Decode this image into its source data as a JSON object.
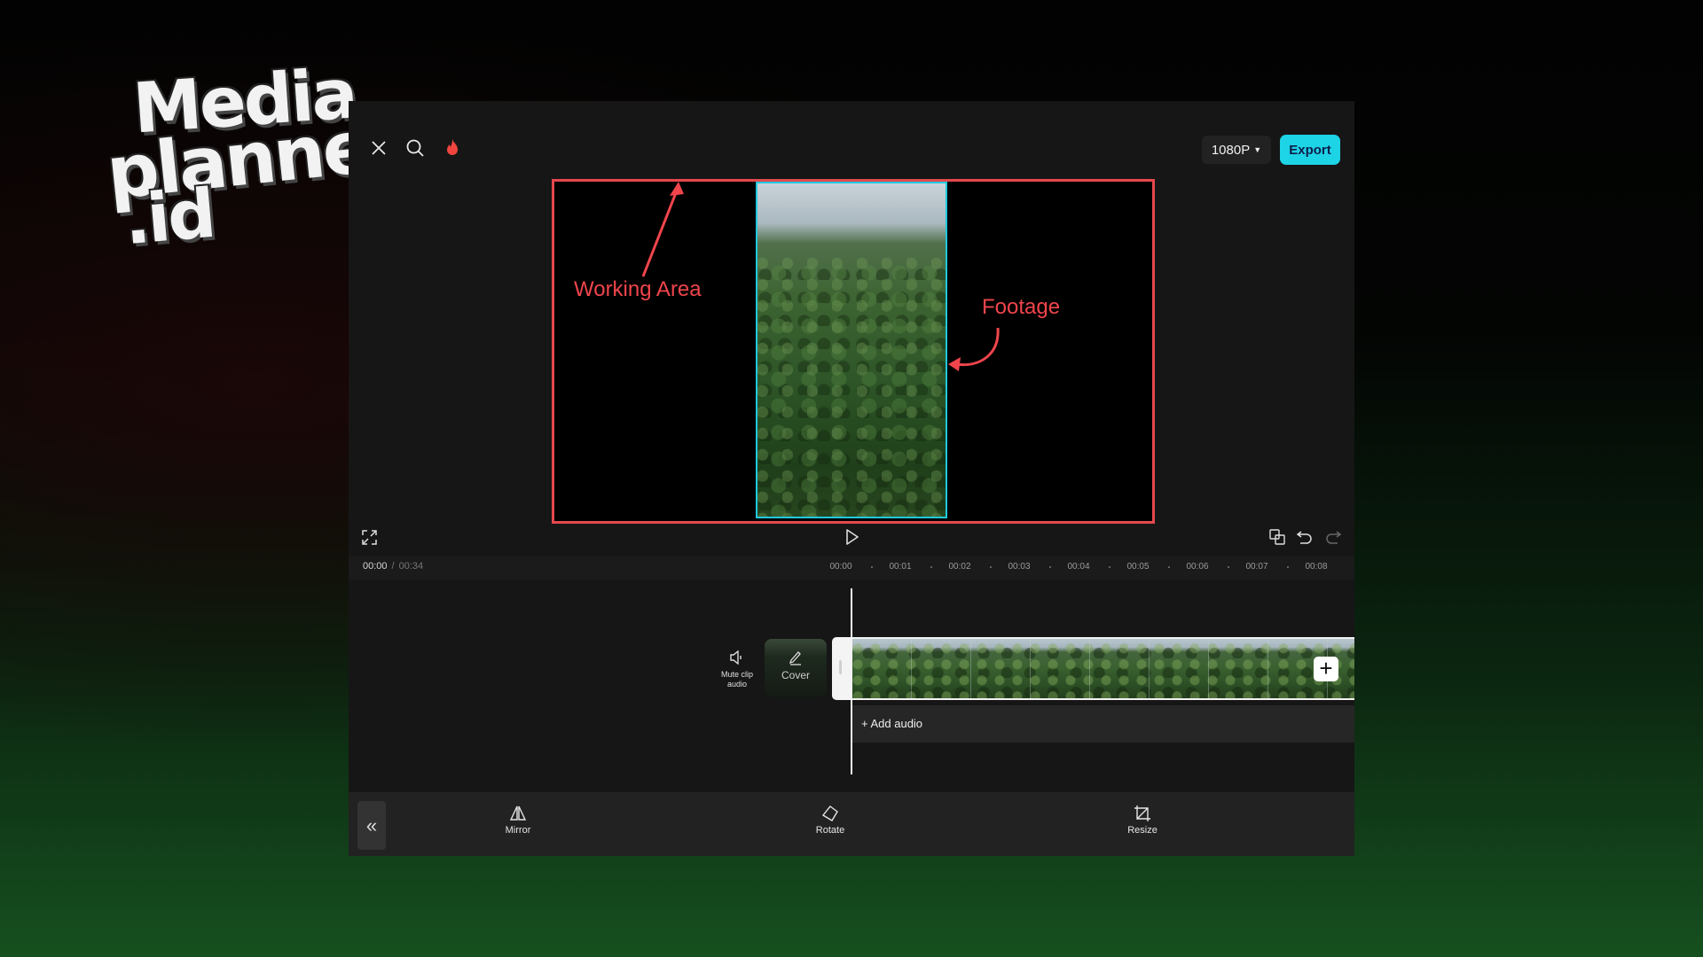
{
  "logo": {
    "line1": "Media",
    "line2": "planner",
    "line3": ".id"
  },
  "header": {
    "icons": [
      "close-icon",
      "search-icon",
      "flame-icon"
    ],
    "resolution": "1080P",
    "export_label": "Export",
    "accent_color": "#1dd3e6"
  },
  "preview": {
    "annotations": {
      "working_area": "Working Area",
      "footage": "Footage"
    },
    "annotation_color": "#f0454c",
    "footage_border_color": "#1fc8de"
  },
  "controls": {
    "fullscreen": "fullscreen-icon",
    "play": "play-icon",
    "actions": [
      "overlay-icon",
      "undo-icon",
      "redo-icon"
    ]
  },
  "timeline": {
    "current_time": "00:00",
    "separator": "/",
    "total_time": "00:34",
    "ruler": [
      "00:00",
      "00:01",
      "00:02",
      "00:03",
      "00:04",
      "00:05",
      "00:06",
      "00:07",
      "00:08"
    ],
    "mute_label": "Mute clip audio",
    "cover_label": "Cover",
    "add_audio": "+ Add audio"
  },
  "toolbar": {
    "tools": [
      {
        "label": "Mirror",
        "icon": "mirror-icon"
      },
      {
        "label": "Rotate",
        "icon": "rotate-icon"
      },
      {
        "label": "Resize",
        "icon": "crop-icon"
      }
    ]
  }
}
